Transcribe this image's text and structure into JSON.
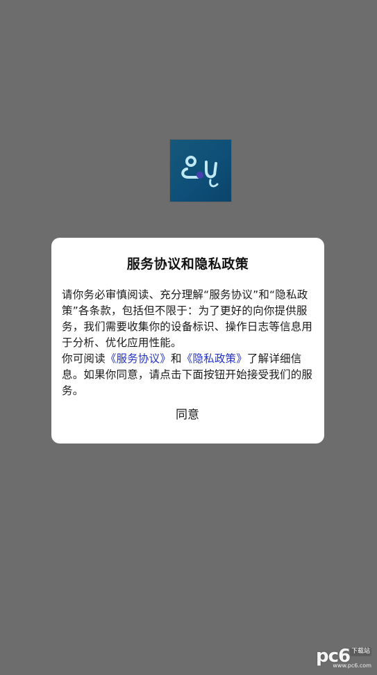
{
  "dialog": {
    "title": "服务协议和隐私政策",
    "paragraph1": "请你务必审慎阅读、充分理解“服务协议”和“隐私政策”各条款，包括但不限于：为了更好的向你提供服务，我们需要收集你的设备标识、操作日志等信息用于分析、优化应用性能。",
    "p2_prefix": "你可阅读",
    "service_link": "《服务协议》",
    "p2_and": "和",
    "privacy_link": "《隐私政策》",
    "p2_suffix": "了解详细信息。如果你同意，请点击下面按钮开始接受我们的服务。",
    "agree_label": "同意"
  },
  "app_logo": {
    "icon": "stethoscope-icon"
  },
  "watermark": {
    "letters": "pc6",
    "badge": "下载站",
    "url": "www.pc6.com"
  },
  "colors": {
    "backdrop": "#6d6d6d",
    "dialog_bg": "#ffffff",
    "link": "#2232c8",
    "logo_bg": "#0e4f78"
  }
}
